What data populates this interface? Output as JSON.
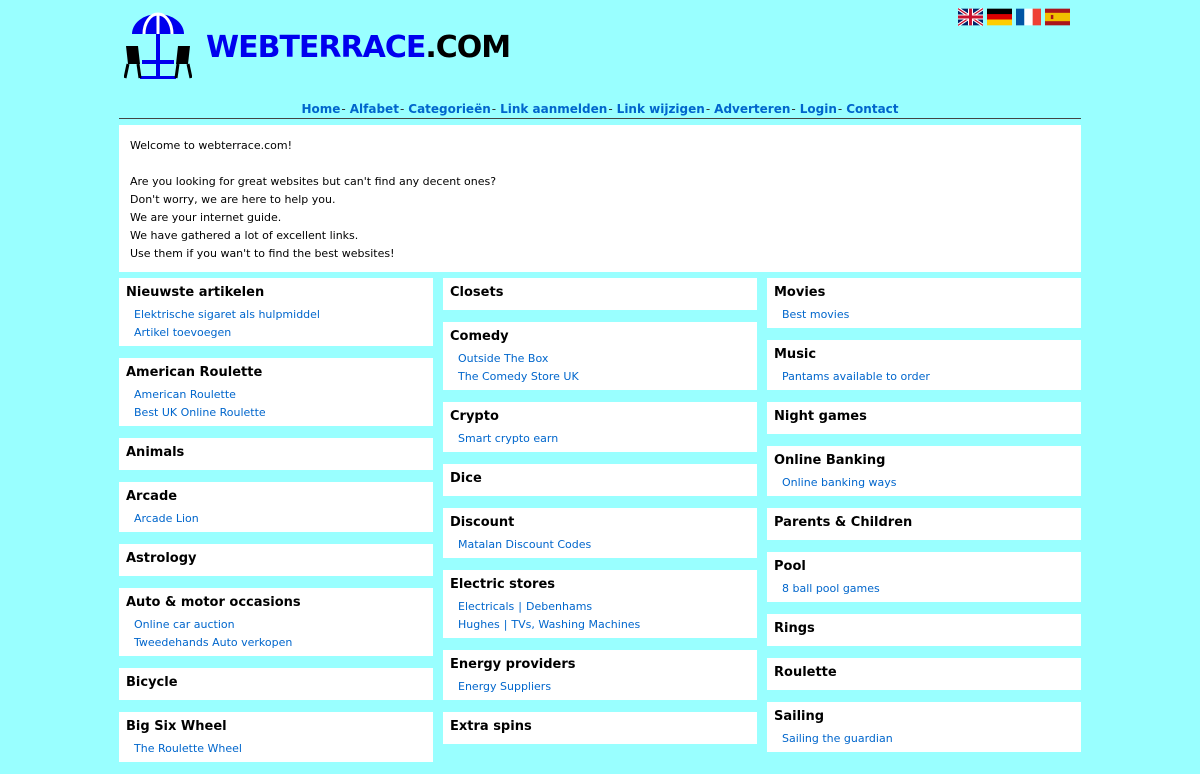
{
  "logo": {
    "brand": "WEBTERRACE",
    "tld": ".COM"
  },
  "flags": [
    {
      "name": "uk-flag-icon"
    },
    {
      "name": "germany-flag-icon"
    },
    {
      "name": "france-flag-icon"
    },
    {
      "name": "spain-flag-icon"
    }
  ],
  "nav": {
    "items": [
      "Home",
      "Alfabet",
      "Categorieën",
      "Link aanmelden",
      "Link wijzigen",
      "Adverteren",
      "Login",
      "Contact"
    ],
    "separator": "-"
  },
  "welcome": {
    "lines": [
      "Welcome to webterrace.com!",
      "",
      "Are you looking for great websites but can't find any decent ones?",
      "Don't worry, we are here to help you.",
      "We are your internet guide.",
      "We have gathered a lot of excellent links.",
      "Use them if you wan't to find the best websites!"
    ]
  },
  "columns": [
    [
      {
        "title": "Nieuwste artikelen",
        "links": [
          [
            "Elektrische sigaret als hulpmiddel"
          ],
          [
            "Artikel toevoegen"
          ]
        ]
      },
      {
        "title": "American Roulette",
        "links": [
          [
            "American Roulette"
          ],
          [
            "Best UK Online Roulette"
          ]
        ]
      },
      {
        "title": "Animals",
        "links": []
      },
      {
        "title": "Arcade",
        "links": [
          [
            "Arcade Lion"
          ]
        ]
      },
      {
        "title": "Astrology",
        "links": []
      },
      {
        "title": "Auto & motor occasions",
        "links": [
          [
            "Online car auction"
          ],
          [
            "Tweedehands Auto verkopen"
          ]
        ]
      },
      {
        "title": "Bicycle",
        "links": []
      },
      {
        "title": "Big Six Wheel",
        "links": [
          [
            "The Roulette Wheel"
          ]
        ]
      }
    ],
    [
      {
        "title": "Closets",
        "links": []
      },
      {
        "title": "Comedy",
        "links": [
          [
            "Outside The Box"
          ],
          [
            "The Comedy Store UK"
          ]
        ]
      },
      {
        "title": "Crypto",
        "links": [
          [
            "Smart crypto earn"
          ]
        ]
      },
      {
        "title": "Dice",
        "links": []
      },
      {
        "title": "Discount",
        "links": [
          [
            "Matalan Discount Codes"
          ]
        ]
      },
      {
        "title": "Electric stores",
        "links": [
          [
            "Electricals",
            "Debenhams"
          ],
          [
            "Hughes",
            "TVs, Washing Machines"
          ]
        ]
      },
      {
        "title": "Energy providers",
        "links": [
          [
            "Energy Suppliers"
          ]
        ]
      },
      {
        "title": "Extra spins",
        "links": []
      }
    ],
    [
      {
        "title": "Movies",
        "links": [
          [
            "Best movies"
          ]
        ]
      },
      {
        "title": "Music",
        "links": [
          [
            "Pantams available to order"
          ]
        ]
      },
      {
        "title": "Night games",
        "links": []
      },
      {
        "title": "Online Banking",
        "links": [
          [
            "Online banking ways"
          ]
        ]
      },
      {
        "title": "Parents & Children",
        "links": []
      },
      {
        "title": "Pool",
        "links": [
          [
            "8 ball pool games"
          ]
        ]
      },
      {
        "title": "Rings",
        "links": []
      },
      {
        "title": "Roulette",
        "links": []
      },
      {
        "title": "Sailing",
        "links": [
          [
            "Sailing the guardian"
          ]
        ]
      }
    ]
  ]
}
